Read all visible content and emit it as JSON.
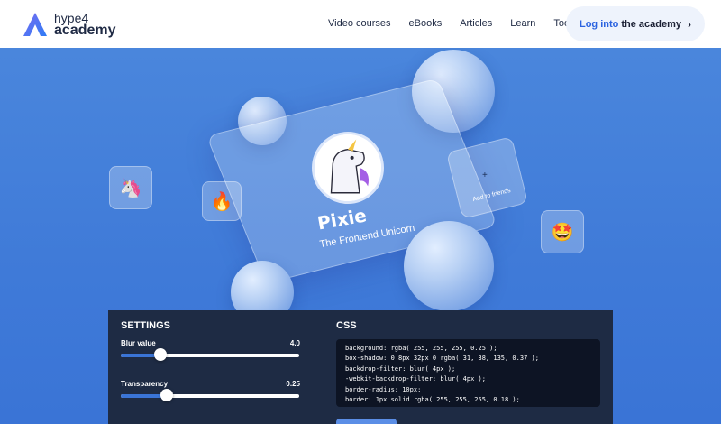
{
  "header": {
    "logo_top": "hype4",
    "logo_bottom": "academy",
    "nav": [
      "Video courses",
      "eBooks",
      "Articles",
      "Learn",
      "Tools"
    ],
    "login_prefix": "Log into",
    "login_strong": "the academy",
    "login_chevron": "›"
  },
  "hero": {
    "card_name": "Pixie",
    "card_subtitle": "The Frontend Unicorn",
    "add_plus": "+",
    "add_label": "Add to friends",
    "tiles": [
      {
        "icon": "unicorn-emoji",
        "glyph": "🦄"
      },
      {
        "icon": "fire-emoji",
        "glyph": "🔥"
      },
      {
        "icon": "star-struck-emoji",
        "glyph": "🤩"
      }
    ]
  },
  "settings": {
    "title": "SETTINGS",
    "blur_label": "Blur value",
    "blur_value": "4.0",
    "blur_fraction": 0.22,
    "transparency_label": "Transparency",
    "transparency_value": "0.25",
    "transparency_fraction": 0.26
  },
  "css": {
    "title": "CSS",
    "code": "background: rgba( 255, 255, 255, 0.25 );\nbox-shadow: 0 8px 32px 0 rgba( 31, 38, 135, 0.37 );\nbackdrop-filter: blur( 4px );\n-webkit-backdrop-filter: blur( 4px );\nborder-radius: 10px;\nborder: 1px solid rgba( 255, 255, 255, 0.18 );"
  },
  "colors": {
    "brand_blue": "#2b63e0",
    "hero_bg": "#4a86dc",
    "panel_bg": "#1e2b44",
    "code_bg": "#0d1424"
  }
}
